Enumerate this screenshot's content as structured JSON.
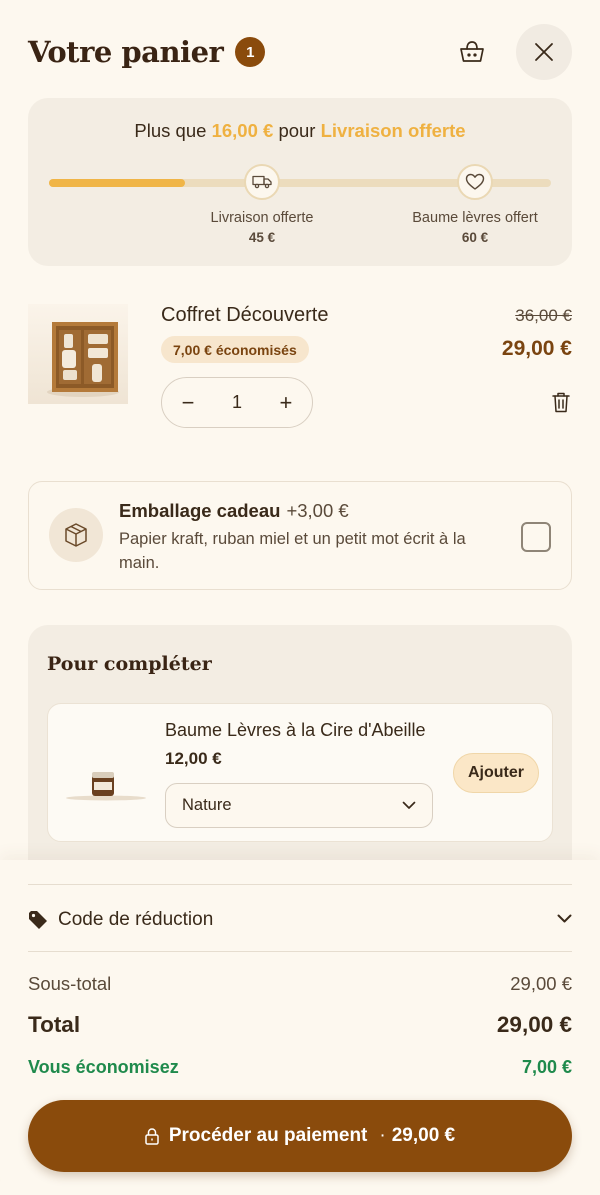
{
  "header": {
    "title": "Votre panier",
    "item_count": "1",
    "basket_icon": "basket-icon",
    "close_icon": "close-icon"
  },
  "shipping": {
    "message_prefix": "Plus que",
    "remaining": "16,00 €",
    "message_middle": "pour",
    "goal": "Livraison offerte",
    "progress": 0.27,
    "milestones": [
      {
        "label": "Livraison offerte",
        "price": "45 €",
        "icon": "truck-icon"
      },
      {
        "label": "Baume lèvres offert",
        "price": "60 €",
        "icon": "heart-icon"
      }
    ]
  },
  "line_item": {
    "name": "Coffret Découverte",
    "savings_badge": "7,00 € économisés",
    "original_price": "36,00 €",
    "price": "29,00 €",
    "quantity": "1",
    "decrement": "−",
    "increment": "+"
  },
  "gift_wrap": {
    "title": "Emballage cadeau",
    "price": "+3,00 €",
    "description": "Papier kraft, ruban miel et un petit mot écrit à la main.",
    "checked": false
  },
  "upsell": {
    "title": "Pour compléter",
    "product": {
      "name": "Baume Lèvres à la Cire d'Abeille",
      "price": "12,00 €",
      "variant": "Nature",
      "add_label": "Ajouter"
    }
  },
  "summary": {
    "promo_label": "Code de réduction",
    "subtotal_label": "Sous-total",
    "subtotal": "29,00 €",
    "total_label": "Total",
    "total": "29,00 €",
    "savings_label": "Vous économisez",
    "savings": "7,00 €",
    "checkout_label": "Procéder au paiement",
    "checkout_amount": "29,00 €"
  },
  "colors": {
    "brand": "#8a4b0c",
    "accent": "#f0b547",
    "savings": "#1f8a4c",
    "background": "#fdf8ef"
  }
}
